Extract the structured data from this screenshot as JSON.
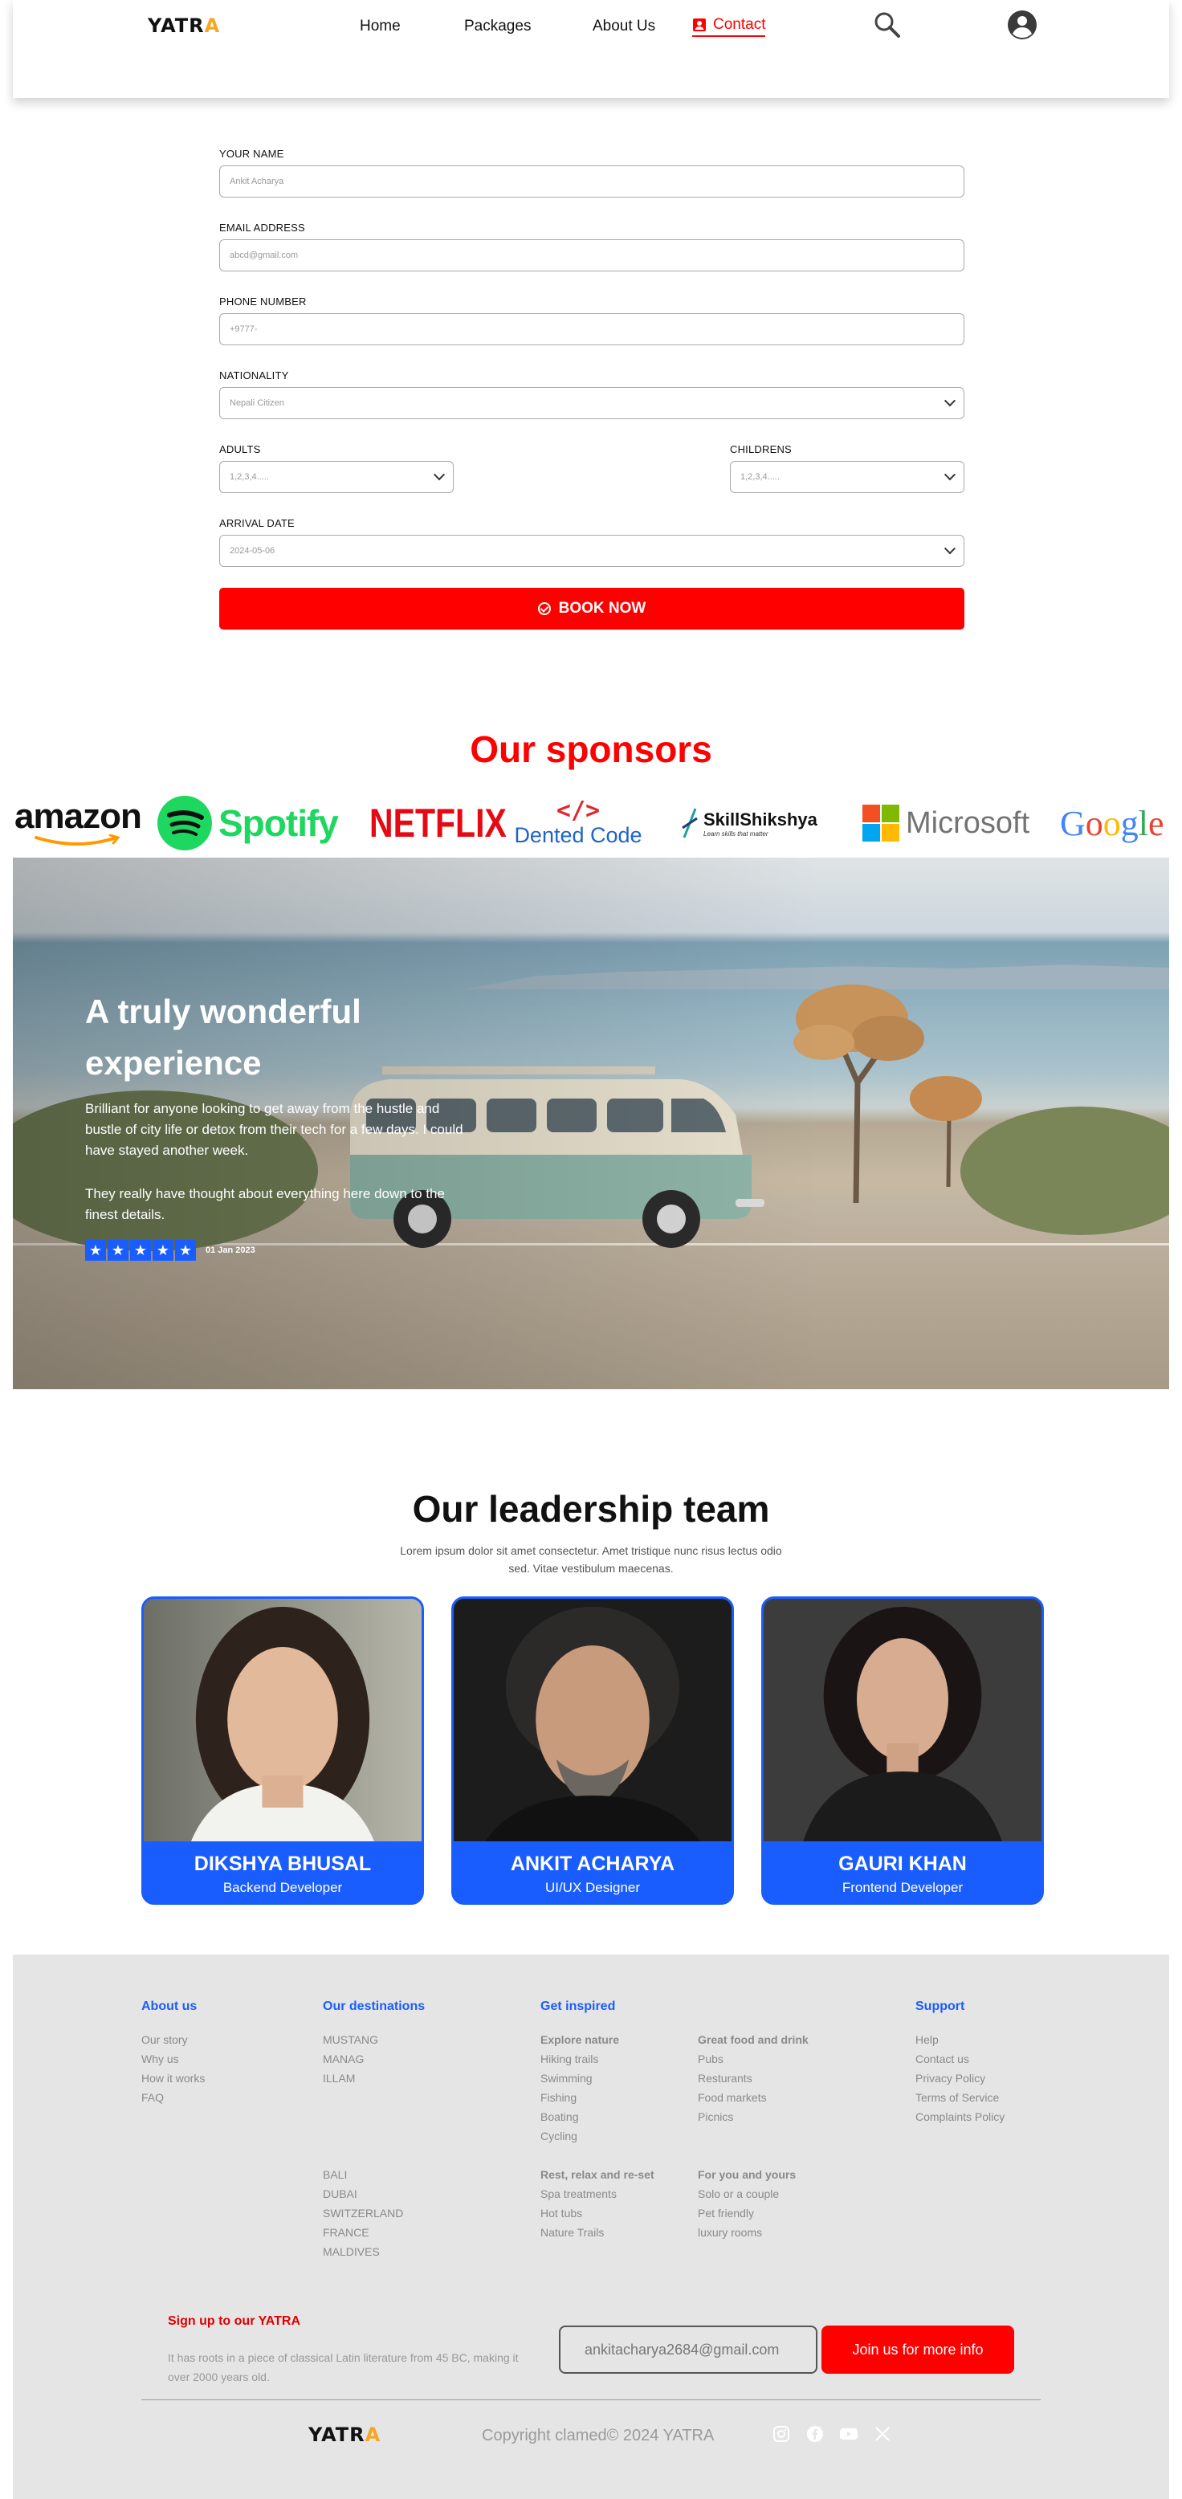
{
  "brand": {
    "logo_a": "YATR",
    "logo_b": "A"
  },
  "nav": {
    "links": [
      "Home",
      "Packages",
      "About Us",
      "Contact"
    ],
    "active": "Contact"
  },
  "form": {
    "name": {
      "label": "YOUR NAME",
      "placeholder": "Ankit Acharya"
    },
    "email": {
      "label": "EMAIL ADDRESS",
      "placeholder": "abcd@gmail.com"
    },
    "phone": {
      "label": "PHONE NUMBER",
      "placeholder": "+9777-"
    },
    "nationality": {
      "label": "NATIONALITY",
      "value": "Nepali Citizen"
    },
    "adults": {
      "label": "ADULTS",
      "value": "1,2,3,4....."
    },
    "children": {
      "label": "CHILDRENS",
      "value": "1,2,3,4....."
    },
    "arrival": {
      "label": "ARRIVAL DATE",
      "value": "2024-05-06"
    },
    "submit": "BOOK NOW"
  },
  "sponsors": {
    "title": "Our sponsors",
    "logos": {
      "amazon": "amazon",
      "spotify": "Spotify",
      "netflix": "NETFLIX",
      "dented_mark": "</>",
      "dented": "Dented Code",
      "skill": "SkillShikshya",
      "skill_tag": "Learn skills that matter",
      "microsoft": "Microsoft",
      "google": "Google"
    }
  },
  "testimonial": {
    "title": "A truly wonderful experience",
    "p1": "Brilliant for anyone looking to get away from the hustle and bustle of city life or detox from their tech for a few days. I could have stayed another week.",
    "p2": "They really have thought about everything here down to the finest details.",
    "rating": 5,
    "date": "01 Jan 2023"
  },
  "team": {
    "title": "Our leadership team",
    "subtitle": "Lorem ipsum dolor sit amet consectetur. Amet tristique nunc risus lectus odio sed. Vitae vestibulum maecenas.",
    "members": [
      {
        "name": "DIKSHYA BHUSAL",
        "role": "Backend Developer"
      },
      {
        "name": "ANKIT ACHARYA",
        "role": "UI/UX Designer"
      },
      {
        "name": "GAURI KHAN",
        "role": "Frontend Developer"
      }
    ]
  },
  "footer": {
    "about": {
      "heading": "About us",
      "items": [
        "Our story",
        "Why us",
        "How it works",
        "FAQ"
      ]
    },
    "destinations": {
      "heading": "Our destinations",
      "items_a": [
        "MUSTANG",
        "MANAG",
        "ILLAM"
      ],
      "items_b": [
        "BALI",
        "DUBAI",
        "SWITZERLAND",
        "FRANCE",
        "MALDIVES"
      ]
    },
    "inspired": {
      "heading": "Get inspired",
      "explore": {
        "title": "Explore nature",
        "items": [
          "Hiking trails",
          "Swimming",
          "Fishing",
          "Boating",
          "Cycling"
        ]
      },
      "food": {
        "title": "Great food and drink",
        "items": [
          "Pubs",
          "Resturants",
          "Food markets",
          "Picnics"
        ]
      },
      "relax": {
        "title": "Rest, relax and re-set",
        "items": [
          "Spa treatments",
          "Hot tubs",
          "Nature Trails"
        ]
      },
      "you": {
        "title": "For you and yours",
        "items": [
          "Solo or a couple",
          "Pet friendly",
          "luxury rooms"
        ]
      }
    },
    "support": {
      "heading": "Support",
      "items": [
        "Help",
        "Contact us",
        "Privacy Policy",
        "Terms of Service",
        "Complaints Policy"
      ]
    },
    "signup": {
      "heading": "Sign up to our YATRA",
      "text": "It has roots in a piece of classical Latin literature from 45 BC, making it over 2000 years old.",
      "email": "ankitacharya2684@gmail.com",
      "button": "Join us for more info"
    },
    "copyright": "Copyright clamed© 2024 YATRA"
  },
  "colors": {
    "accent": "#ff0000",
    "blue": "#1a5dff",
    "brand_orange": "#f5a623"
  }
}
